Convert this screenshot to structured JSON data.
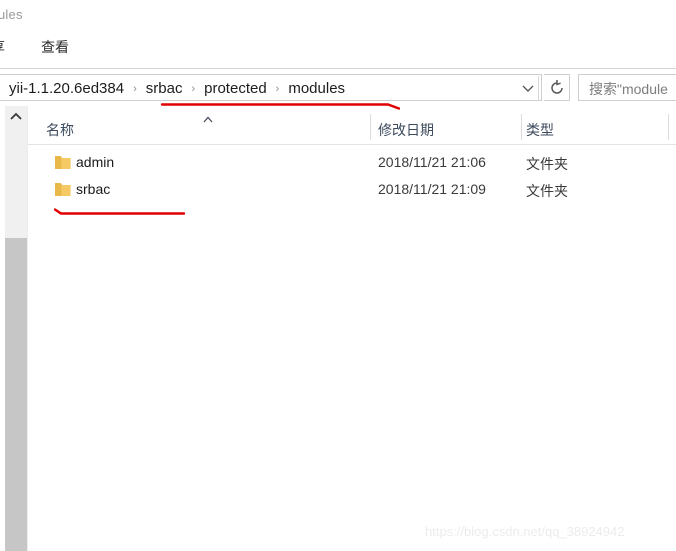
{
  "window": {
    "title_fragment": "ules"
  },
  "ribbon": {
    "tabs": [
      {
        "label": "享",
        "name": "tab-share"
      },
      {
        "label": "查看",
        "name": "tab-view"
      }
    ]
  },
  "address_bar": {
    "breadcrumb": [
      "yii-1.1.20.6ed384",
      "srbac",
      "protected",
      "modules"
    ],
    "separator": "›",
    "dropdown_icon": "chevron-down-icon",
    "refresh_icon": "refresh-icon"
  },
  "search": {
    "placeholder": "搜索\"module"
  },
  "columns": {
    "name": "名称",
    "date_modified": "修改日期",
    "type": "类型"
  },
  "files": [
    {
      "name": "admin",
      "date_modified": "2018/11/21 21:06",
      "type": "文件夹",
      "icon": "folder-icon"
    },
    {
      "name": "srbac",
      "date_modified": "2018/11/21 21:09",
      "type": "文件夹",
      "icon": "folder-icon"
    }
  ],
  "annotations": {
    "breadcrumb_underline_color": "#e00000",
    "srbac_underline_color": "#e00000"
  },
  "watermark": {
    "text": "https://blog.csdn.net/qq_38924942"
  },
  "colors": {
    "folder_yellow": "#f6c champ",
    "header_text": "#3c4a5c",
    "accent_red": "#e00000",
    "scrollbar_thumb": "#c6c6c6",
    "scrollbar_track": "#f0f0f0"
  }
}
